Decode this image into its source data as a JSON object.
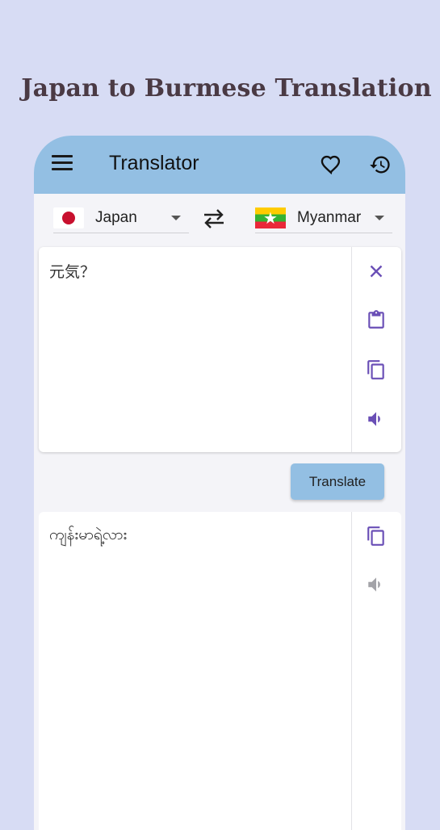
{
  "promo": {
    "title": "Japan to Burmese Translation"
  },
  "appbar": {
    "title": "Translator",
    "menu_icon": "menu-icon",
    "favorite_icon": "heart-outline-icon",
    "history_icon": "history-icon"
  },
  "languages": {
    "source": {
      "name": "Japan",
      "flag": "japan-flag"
    },
    "target": {
      "name": "Myanmar",
      "flag": "myanmar-flag"
    },
    "swap_icon": "swap-arrows-icon"
  },
  "input": {
    "text": "元気？",
    "icons": [
      "close-icon",
      "clipboard-icon",
      "copy-icon",
      "volume-icon"
    ]
  },
  "translate_button": {
    "label": "Translate"
  },
  "output": {
    "text": "ကျန်းမာရဲ့လား",
    "icons": [
      "copy-icon",
      "volume-icon"
    ]
  },
  "colors": {
    "background": "#d7dcf4",
    "appbar": "#93bfe3",
    "accent": "#6a4fb6",
    "disabled_icon": "#a3a3a8"
  }
}
